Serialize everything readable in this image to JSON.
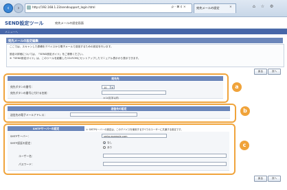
{
  "browser": {
    "address": "http://192.168.1.23/sendsupport_login.html",
    "address_tools": "ρ - ⊠ ¢ ×",
    "tab_title": "宛先メールの設定",
    "tab_close": "×",
    "window_icons": "⌂ ☆ ⚙"
  },
  "app": {
    "title": "SEND設定ツール",
    "subtitle": "宛先メールの設定画面",
    "nav_link": "メニューへ"
  },
  "page": {
    "heading": "宛先メールの設定編集",
    "intro": [
      "ここでは、スキャンした原稿をデバイスから電子メールで送信するための設定を行います。",
      "設定の詳細については、「SEND設定ガイド」をご参照ください。",
      "※「SEND設定ガイド」は、このツールを起動したCD-ROMにセットアップしたマニュアル表示から表示できます。"
    ],
    "buttons_top": {
      "back": "戻る",
      "next": "次へ"
    },
    "buttons_bottom": {
      "back": "戻る",
      "next": "次へ"
    }
  },
  "section_a": {
    "header": "宛先先",
    "badge": "a",
    "fields": {
      "register_label": "宛先ボタンの番号：",
      "register_value": "10",
      "name_label": "宛先ボタンの番号に付ける名前：",
      "name_value": "",
      "name_hint": "＊14文字以内"
    }
  },
  "section_b": {
    "header": "送信先の設定",
    "badge": "b",
    "fields": {
      "email_label": "送信先の電子メールアドレス：",
      "email_value": ""
    }
  },
  "section_c": {
    "header": "SMTPサーバーの設定",
    "badge": "c",
    "note": "＊ SMTPサーバーの設定は、このデバイスを使用するすべてのユーザーに共通する設定です。",
    "fields": {
      "server_label": "SMTPサーバー：",
      "server_value": "smtp.example.com",
      "auth_label": "SMTP認証の設定：",
      "auth_options": [
        "なし",
        "あり"
      ],
      "auth_selected": "なし",
      "user_label": "ユーザー名：",
      "user_value": "",
      "password_label": "パスワード：",
      "password_value": ""
    }
  },
  "colors": {
    "accent": "#f0a33a",
    "header_blue": "#6b86ba",
    "brand": "#2a4f92"
  }
}
